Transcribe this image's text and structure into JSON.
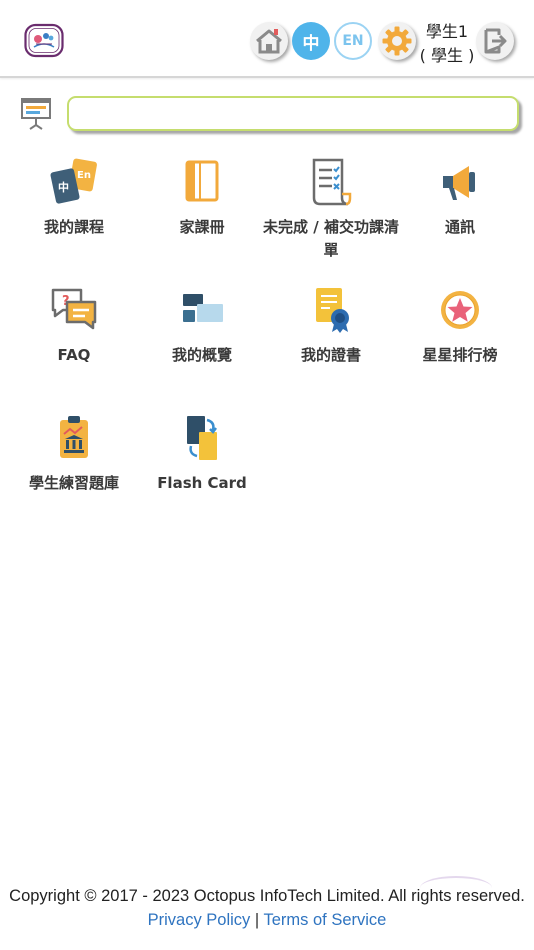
{
  "header": {
    "language_zh": "中",
    "language_en": "EN",
    "user_name": "學生1",
    "user_role": "( 學生 )",
    "colors": {
      "lang_active": "#4fb4ea",
      "lang_inactive_border": "#9bd3f3",
      "icon_gray": "#8a8a8a"
    },
    "icons": [
      "school-logo-icon",
      "home-icon",
      "gear-icon",
      "logout-icon"
    ]
  },
  "search": {
    "value": "",
    "placeholder": "",
    "icon": "presentation-board-icon",
    "border_color": "#c5dd6e"
  },
  "menu": {
    "items": [
      {
        "label": "我的課程",
        "icon": "courses-cards-icon"
      },
      {
        "label": "家課冊",
        "icon": "homework-book-icon"
      },
      {
        "label": "未完成 / 補交功課清單",
        "icon": "checklist-document-icon"
      },
      {
        "label": "通訊",
        "icon": "megaphone-icon"
      },
      {
        "label": "FAQ",
        "icon": "faq-chat-icon"
      },
      {
        "label": "我的概覽",
        "icon": "overview-blocks-icon"
      },
      {
        "label": "我的證書",
        "icon": "certificate-icon"
      },
      {
        "label": "星星排行榜",
        "icon": "star-badge-icon"
      },
      {
        "label": "學生練習題庫",
        "icon": "exercise-bank-icon"
      },
      {
        "label": "Flash Card",
        "icon": "flash-card-icon"
      }
    ]
  },
  "footer": {
    "copyright": "Copyright © 2017 - 2023 Octopus InfoTech Limited. All rights reserved.",
    "privacy": "Privacy Policy",
    "separator": "|",
    "terms": "Terms of Service",
    "link_color": "#2f74c0"
  }
}
